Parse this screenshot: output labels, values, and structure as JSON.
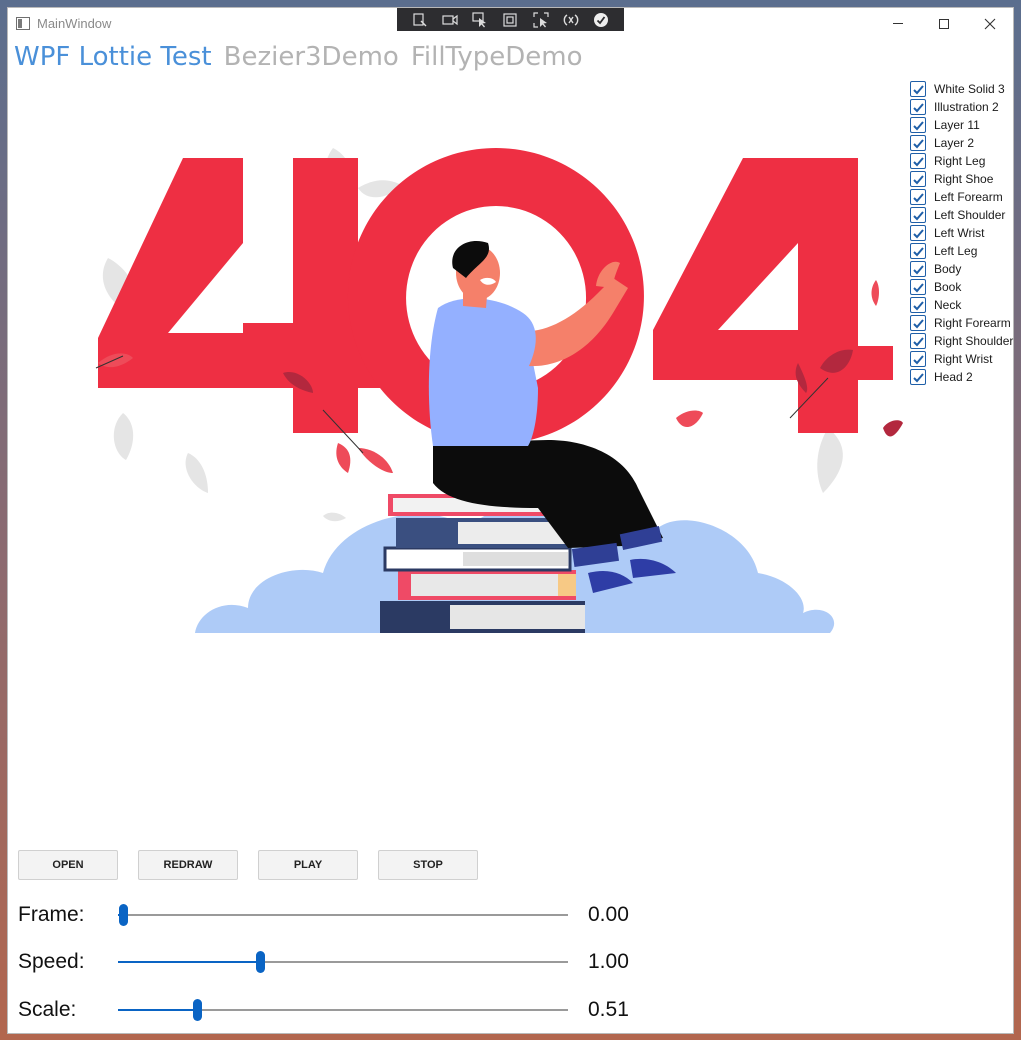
{
  "window": {
    "title": "MainWindow"
  },
  "tabs": [
    {
      "label": "WPF Lottie Test",
      "active": true
    },
    {
      "label": "Bezier3Demo",
      "active": false
    },
    {
      "label": "FillTypeDemo",
      "active": false
    }
  ],
  "debug_toolbar": {
    "icons": [
      "select-element-icon",
      "record-icon",
      "pointer-icon",
      "frame-icon",
      "inspect-icon",
      "hot-reload-icon",
      "checkmark-icon"
    ]
  },
  "layers": [
    {
      "label": "White Solid 3",
      "checked": true
    },
    {
      "label": "Illustration 2",
      "checked": true
    },
    {
      "label": "Layer 11",
      "checked": true
    },
    {
      "label": "Layer 2",
      "checked": true
    },
    {
      "label": "Right Leg",
      "checked": true
    },
    {
      "label": "Right Shoe",
      "checked": true
    },
    {
      "label": "Left Forearm",
      "checked": true
    },
    {
      "label": "Left Shoulder",
      "checked": true
    },
    {
      "label": "Left Wrist",
      "checked": true
    },
    {
      "label": "Left Leg",
      "checked": true
    },
    {
      "label": "Body",
      "checked": true
    },
    {
      "label": "Book",
      "checked": true
    },
    {
      "label": "Neck",
      "checked": true
    },
    {
      "label": "Right Forearm",
      "checked": true
    },
    {
      "label": "Right Shoulder",
      "checked": true
    },
    {
      "label": "Right Wrist",
      "checked": true
    },
    {
      "label": "Head 2",
      "checked": true
    }
  ],
  "illustration": {
    "text": "404",
    "primary_color": "#ee2f43",
    "cloud_color": "#aecbf7"
  },
  "buttons": {
    "open": "OPEN",
    "redraw": "REDRAW",
    "play": "PLAY",
    "stop": "STOP"
  },
  "sliders": {
    "frame": {
      "label": "Frame:",
      "value": "0.00",
      "fraction": 0.01
    },
    "speed": {
      "label": "Speed:",
      "value": "1.00",
      "fraction": 0.315
    },
    "scale": {
      "label": "Scale:",
      "value": "0.51",
      "fraction": 0.175
    }
  },
  "colors": {
    "accent": "#0a64c4",
    "tab_active": "#4a90d9",
    "tab_inactive": "#b3b3b3"
  }
}
